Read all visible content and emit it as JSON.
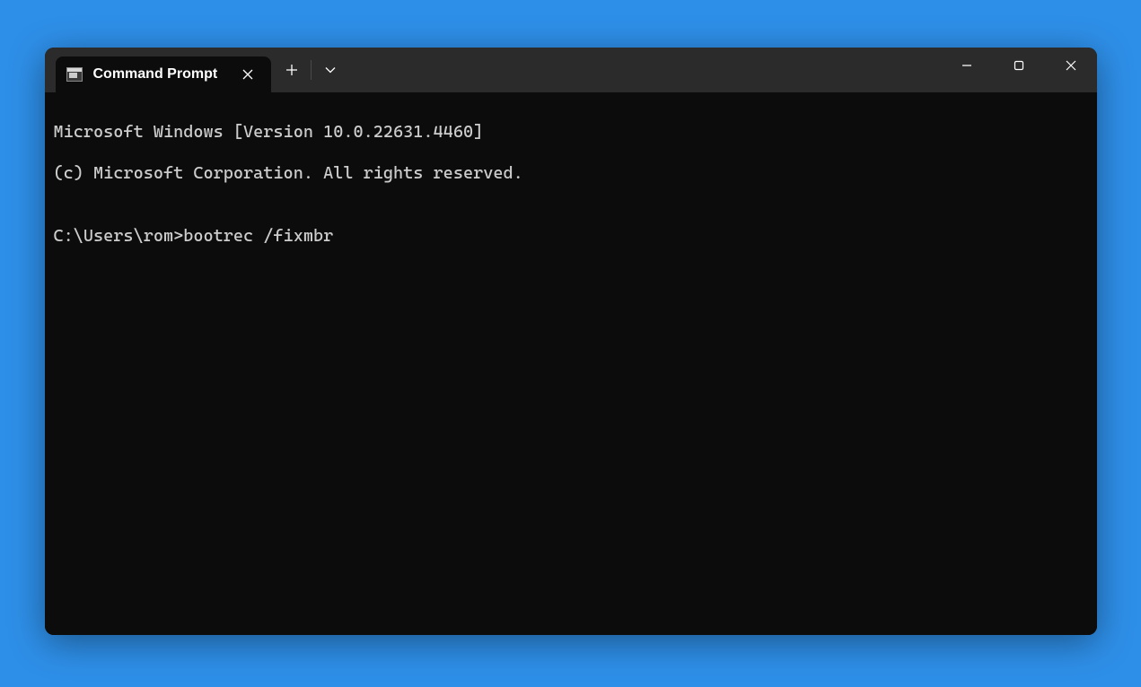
{
  "tab": {
    "title": "Command Prompt"
  },
  "terminal": {
    "line1": "Microsoft Windows [Version 10.0.22631.4460]",
    "line2": "(c) Microsoft Corporation. All rights reserved.",
    "blank1": "",
    "prompt_line": "C:\\Users\\rom>bootrec /fixmbr"
  }
}
